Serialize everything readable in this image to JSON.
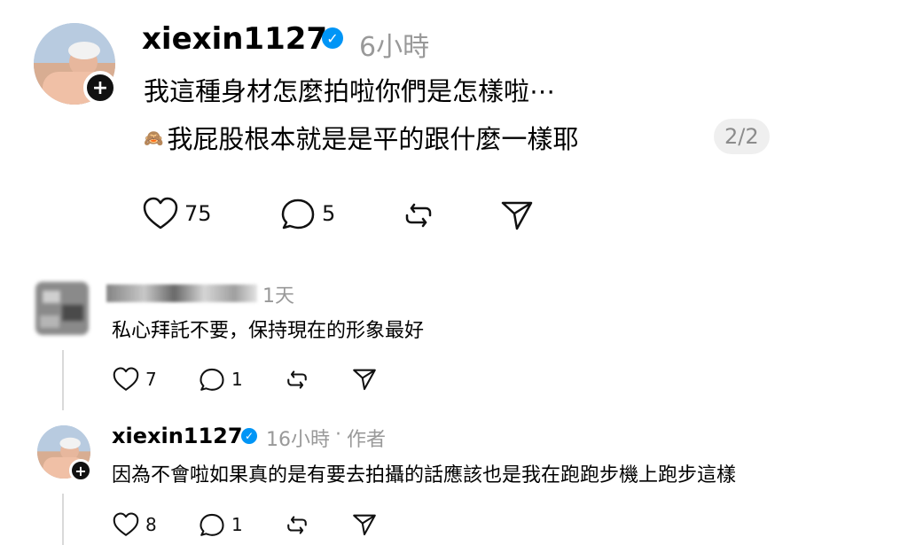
{
  "main_post": {
    "username": "xiexin1127",
    "time": "6小時",
    "line1": "我這種身材怎麼拍啦你們是怎樣啦⋯",
    "line2_glyph": "🙈",
    "line2_text": "我屁股根本就是是平的跟什麼一樣耶",
    "page_indicator": "2/2",
    "likes": "75",
    "replies": "5"
  },
  "comments": [
    {
      "username": "",
      "time": "1天",
      "text": "私心拜託不要，保持現在的形象最好",
      "likes": "7",
      "replies": "1"
    },
    {
      "username": "xiexin1127",
      "time": "16小時",
      "author_tag": "作者",
      "text": "因為不會啦如果真的是有要去拍攝的話應該也是我在跑跑步機上跑步這樣",
      "likes": "8",
      "replies": "1"
    }
  ],
  "icons": {
    "verified": "verified-icon",
    "like": "heart-icon",
    "reply": "comment-icon",
    "repost": "repost-icon",
    "share": "send-icon",
    "follow": "plus-icon"
  },
  "colors": {
    "verified": "#0095f6",
    "muted": "#999999",
    "pill_bg": "#efefef"
  }
}
